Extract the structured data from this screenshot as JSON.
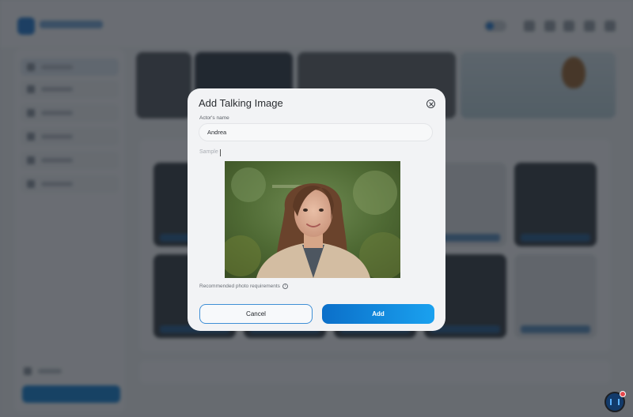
{
  "modal": {
    "title": "Add Talking Image",
    "actor_name_label": "Actor's name",
    "actor_name_value": "Andrea",
    "sample_label": "Sample",
    "requirements_link": "Recommended photo requirements",
    "info_icon": "info-icon",
    "close_icon": "close-circle-icon",
    "cancel_label": "Cancel",
    "add_label": "Add"
  },
  "colors": {
    "accent_start": "#0b6fc9",
    "accent_end": "#1aa1ef",
    "overlay": "rgba(20,24,30,0.62)",
    "modal_bg": "#f2f3f5"
  },
  "background": {
    "chat_widget_icon": "audio-wave-icon",
    "chat_badge_color": "#e5484d"
  }
}
